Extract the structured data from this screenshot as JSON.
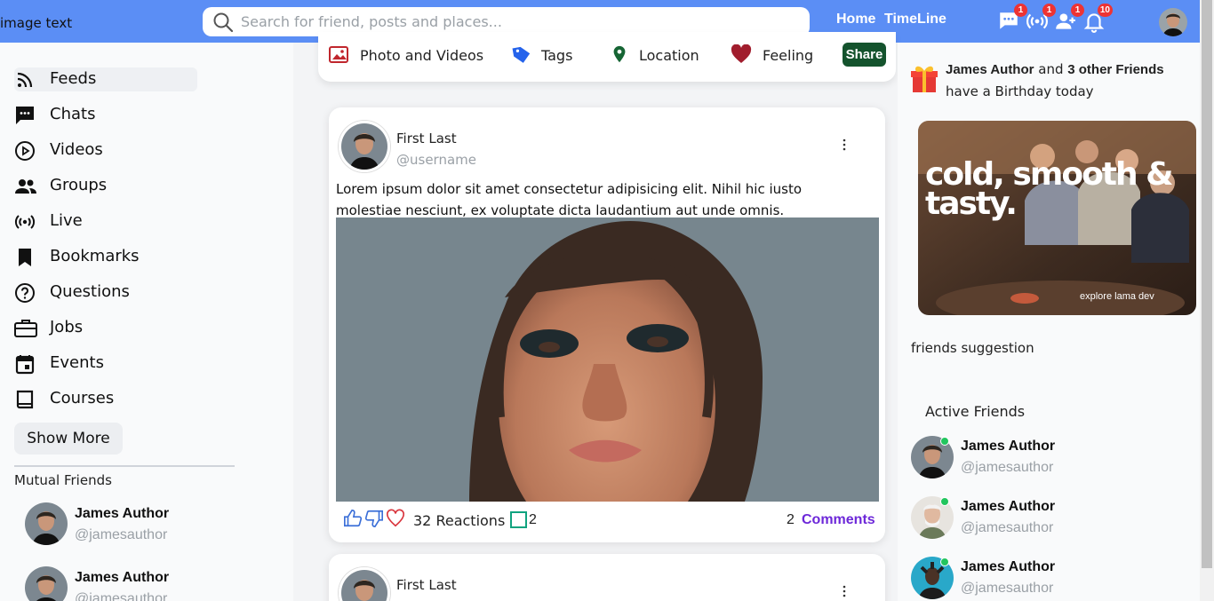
{
  "brand": "image  text",
  "search": {
    "placeholder": "Search for friend, posts and places..."
  },
  "top_nav": {
    "home": "Home",
    "timeline": "TimeLine"
  },
  "notifications": [
    {
      "icon": "chat-icon",
      "count": "1"
    },
    {
      "icon": "live-icon",
      "count": "1"
    },
    {
      "icon": "friend-request-icon",
      "count": "1"
    },
    {
      "icon": "bell-icon",
      "count": "10"
    }
  ],
  "sidebar": {
    "items": [
      {
        "label": "Feeds",
        "icon": "rss-icon"
      },
      {
        "label": "Chats",
        "icon": "chat-icon"
      },
      {
        "label": "Videos",
        "icon": "play-circle-icon"
      },
      {
        "label": "Groups",
        "icon": "group-icon"
      },
      {
        "label": "Live",
        "icon": "live-icon"
      },
      {
        "label": "Bookmarks",
        "icon": "bookmark-icon"
      },
      {
        "label": "Questions",
        "icon": "question-icon"
      },
      {
        "label": "Jobs",
        "icon": "briefcase-icon"
      },
      {
        "label": "Events",
        "icon": "calendar-icon"
      },
      {
        "label": "Courses",
        "icon": "book-icon"
      }
    ],
    "show_more": "Show More",
    "mutual_title": "Mutual Friends",
    "mutual_friends": [
      {
        "name": "James Author",
        "username": "@jamesauthor"
      },
      {
        "name": "James Author",
        "username": "@jamesauthor"
      }
    ]
  },
  "share": {
    "options": [
      "Photo and Videos",
      "Tags",
      "Location",
      "Feeling"
    ],
    "button": "Share"
  },
  "posts": [
    {
      "name": "First Last",
      "username": "@username",
      "text": "Lorem ipsum dolor sit amet consectetur adipisicing elit. Nihil hic iusto molestiae nesciunt, ex voluptate dicta laudantium aut unde omnis.",
      "reactions": "32 Reactions",
      "shares": "2",
      "comments_count": "2",
      "comments_label": "Comments"
    },
    {
      "name": "First Last"
    }
  ],
  "right": {
    "birthday": {
      "name": "James Author",
      "mid": " and ",
      "others": "3 other Friends",
      "rest": " have a Birthday today"
    },
    "ad": {
      "headline": "cold, smooth & tasty.",
      "tagline": "explore lama dev"
    },
    "friends_suggestion": "friends suggestion",
    "active_title": "Active Friends",
    "active_friends": [
      {
        "name": "James Author",
        "username": "@jamesauthor"
      },
      {
        "name": "James Author",
        "username": "@jamesauthor"
      },
      {
        "name": "James Author",
        "username": "@jamesauthor"
      }
    ]
  },
  "colors": {
    "topbar": "#5b8ef5",
    "share_button": "#14532d",
    "comments_link": "#6d28d9",
    "online": "#22c55e",
    "badge": "#e33333"
  }
}
